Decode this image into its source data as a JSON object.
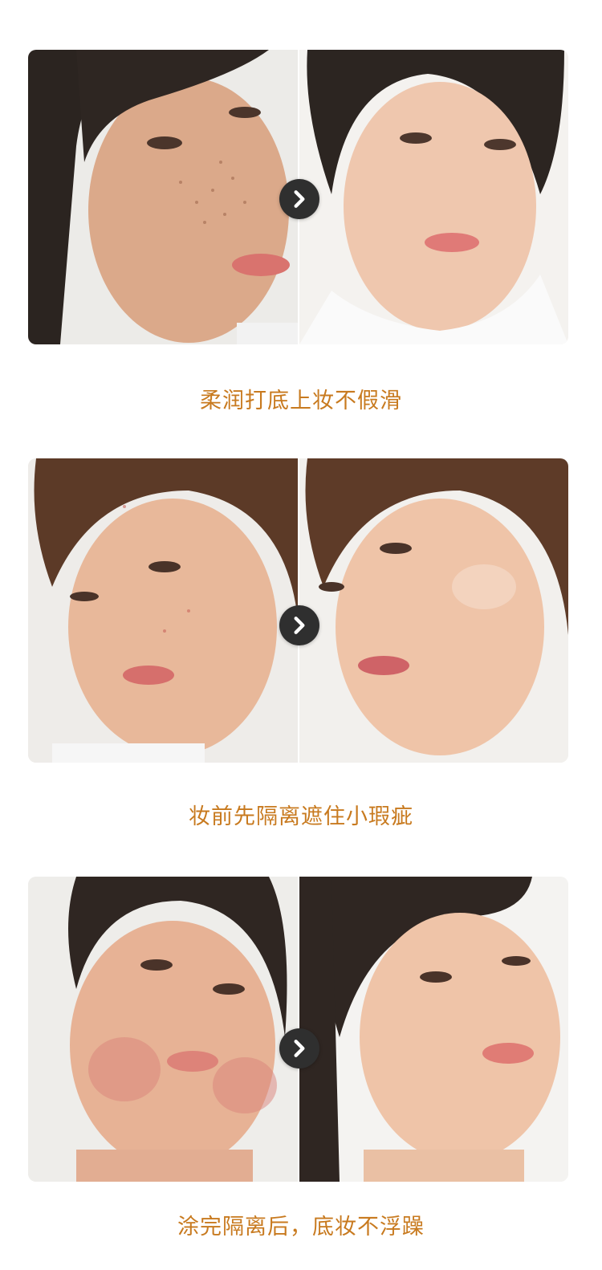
{
  "accent_color": "#c87a1f",
  "arrow_icon": "chevron-right-icon",
  "comparisons": [
    {
      "before_image": "face-before-freckles",
      "after_image": "face-after-smooth",
      "caption": "柔润打底上妆不假滑"
    },
    {
      "before_image": "face-before-blemishes",
      "after_image": "face-after-glow",
      "caption": "妆前先隔离遮住小瑕疵"
    },
    {
      "before_image": "face-before-redness",
      "after_image": "face-after-even",
      "caption": "涂完隔离后，底妆不浮躁"
    }
  ]
}
